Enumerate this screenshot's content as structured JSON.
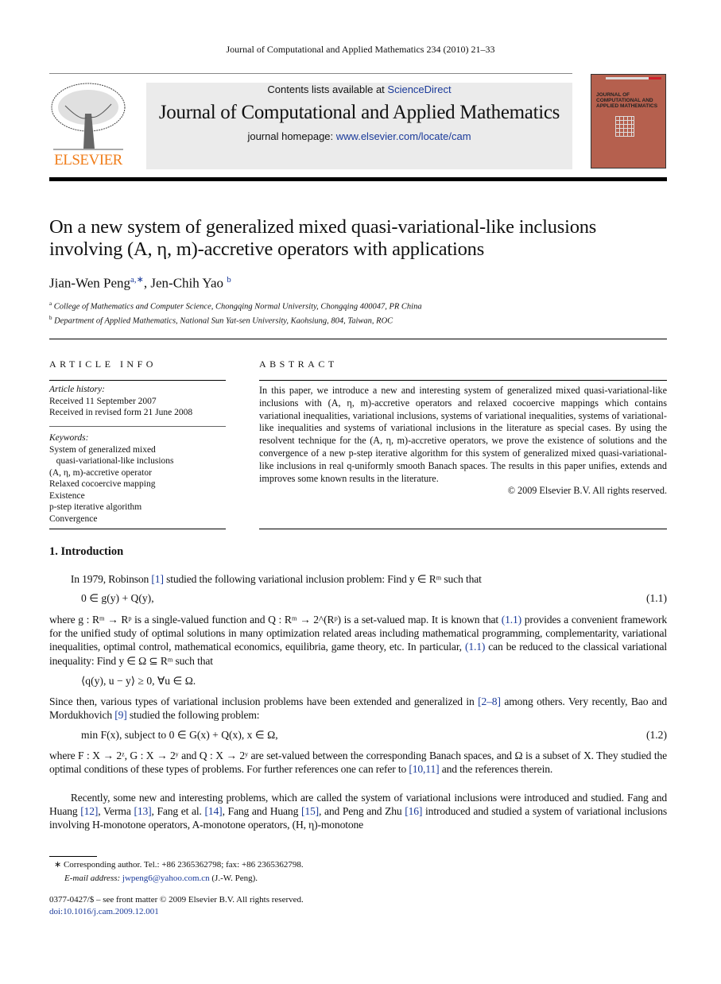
{
  "running_header": "Journal of Computational and Applied Mathematics 234 (2010) 21–33",
  "publisher_logo": "ELSEVIER",
  "banner": {
    "contents_prefix": "Contents lists available at ",
    "contents_link": "ScienceDirect",
    "journal_title": "Journal of Computational and Applied Mathematics",
    "homepage_prefix": "journal homepage: ",
    "homepage_link": "www.elsevier.com/locate/cam"
  },
  "cover": {
    "title": "JOURNAL OF COMPUTATIONAL AND APPLIED MATHEMATICS"
  },
  "article": {
    "title": "On a new system of generalized mixed quasi-variational-like inclusions involving (A, η, m)-accretive operators with applications",
    "authors": [
      {
        "name": "Jian-Wen Peng",
        "sup": "a,∗"
      },
      {
        "name": "Jen-Chih Yao",
        "sup": "b"
      }
    ],
    "affiliations": [
      {
        "label": "a",
        "text": "College of Mathematics and Computer Science, Chongqing Normal University, Chongqing 400047, PR China"
      },
      {
        "label": "b",
        "text": "Department of Applied Mathematics, National Sun Yat-sen University, Kaohsiung, 804, Taiwan, ROC"
      }
    ]
  },
  "article_info": {
    "heading": "ARTICLE INFO",
    "history_label": "Article history:",
    "history": [
      "Received 11 September 2007",
      "Received in revised form 21 June 2008"
    ],
    "keywords_label": "Keywords:",
    "keywords": [
      "System of generalized mixed",
      "   quasi-variational-like inclusions",
      "(A, η, m)-accretive operator",
      "Relaxed cocoercive mapping",
      "Existence",
      "p-step iterative algorithm",
      "Convergence"
    ]
  },
  "abstract": {
    "heading": "ABSTRACT",
    "text": "In this paper, we introduce a new and interesting system of generalized mixed quasi-variational-like inclusions with (A, η, m)-accretive operators and relaxed cocoercive mappings which contains variational inequalities, variational inclusions, systems of variational inequalities, systems of variational-like inequalities and systems of variational inclusions in the literature as special cases. By using the resolvent technique for the (A, η, m)-accretive operators, we prove the existence of solutions and the convergence of a new p-step iterative algorithm for this system of generalized mixed quasi-variational-like inclusions in real q-uniformly smooth Banach spaces. The results in this paper unifies, extends and improves some known results in the literature.",
    "copyright": "© 2009 Elsevier B.V. All rights reserved."
  },
  "intro": {
    "heading": "1.  Introduction",
    "p1": [
      {
        "t": "  In 1979, Robinson "
      },
      {
        "t": "[1]",
        "l": 1
      },
      {
        "t": " studied the following variational inclusion problem: Find y ∈ Rᵐ such that"
      }
    ],
    "eq1": {
      "expr": "0 ∈ g(y) + Q(y),",
      "num": "(1.1)"
    },
    "p2": [
      {
        "t": "where g : Rᵐ → Rᵖ is a single-valued function and Q : Rᵐ → 2^(Rᵖ) is a set-valued map. It is known that "
      },
      {
        "t": "(1.1)",
        "l": 1
      },
      {
        "t": " provides a convenient framework for the unified study of optimal solutions in many optimization related areas including mathematical programming, complementarity, variational inequalities, optimal control, mathematical economics, equilibria, game theory, etc. In particular, "
      },
      {
        "t": "(1.1)",
        "l": 1
      },
      {
        "t": " can be reduced to the classical variational inequality: Find y ∈ Ω ⊆ Rᵐ such that"
      }
    ],
    "eq_vi": "⟨q(y), u − y⟩ ≥ 0,    ∀u ∈ Ω.",
    "p3": [
      {
        "t": "Since then, various types of variational inclusion problems have been extended and generalized in "
      },
      {
        "t": "[2–8]",
        "l": 1
      },
      {
        "t": " among others. Very recently, Bao and Mordukhovich "
      },
      {
        "t": "[9]",
        "l": 1
      },
      {
        "t": " studied the following problem:"
      }
    ],
    "eq2": {
      "expr": "min F(x),  subject to 0 ∈ G(x) + Q(x),    x ∈ Ω,",
      "num": "(1.2)"
    },
    "p4": [
      {
        "t": "where F : X → 2ᶻ, G : X → 2ʸ and Q : X → 2ʸ are set-valued between the corresponding Banach spaces, and Ω is a subset of X. They studied the optimal conditions of these types of problems. For further references one can refer to "
      },
      {
        "t": "[10,11]",
        "l": 1
      },
      {
        "t": " and the references therein."
      }
    ],
    "p5": [
      {
        "t": "  Recently, some new and interesting problems, which are called the system of variational inclusions were introduced and studied. Fang and Huang "
      },
      {
        "t": "[12]",
        "l": 1
      },
      {
        "t": ", Verma "
      },
      {
        "t": "[13]",
        "l": 1
      },
      {
        "t": ", Fang et al. "
      },
      {
        "t": "[14]",
        "l": 1
      },
      {
        "t": ", Fang and Huang "
      },
      {
        "t": "[15]",
        "l": 1
      },
      {
        "t": ", and Peng and Zhu "
      },
      {
        "t": "[16]",
        "l": 1
      },
      {
        "t": " introduced and studied a system of variational inclusions involving H-monotone operators, A-monotone operators, (H, η)-monotone"
      }
    ]
  },
  "footnotes": {
    "corresponding": "∗  Corresponding author. Tel.: +86 2365362798; fax: +86 2365362798.",
    "email_label": "E-mail address: ",
    "email": "jwpeng6@yahoo.com.cn",
    "email_suffix": " (J.-W. Peng).",
    "front_matter": "0377-0427/$ – see front matter © 2009 Elsevier B.V. All rights reserved.",
    "doi": "doi:10.1016/j.cam.2009.12.001"
  },
  "colors": {
    "link": "#1a3a9a",
    "elsevier": "#f07d1a",
    "banner_bg": "#ebebeb",
    "cover": "#b5604e"
  }
}
